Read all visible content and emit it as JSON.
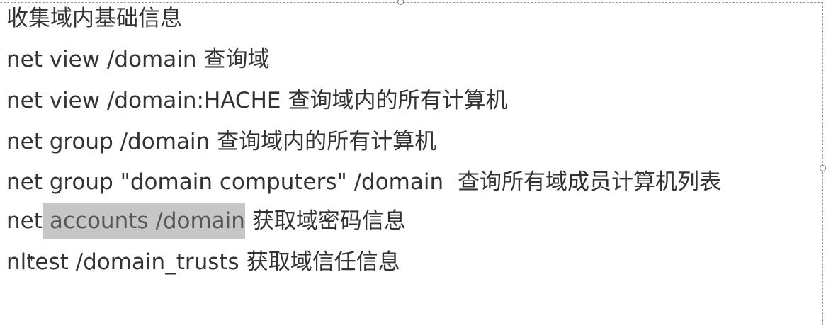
{
  "title": "收集域内基础信息",
  "lines": [
    {
      "cmd": "net view /domain",
      "desc": "查询域"
    },
    {
      "cmd": "net view /domain:HACHE",
      "desc": "查询域内的所有计算机"
    },
    {
      "cmd": "net group /domain",
      "desc": "查询域内的所有计算机"
    },
    {
      "cmd": "net group \"domain computers\" /domain",
      "desc": "查询所有域成员计算机列表"
    },
    {
      "cmd_prefix": "net",
      "cmd_highlight": "accounts /domain",
      "desc": "获取域密码信息"
    },
    {
      "cmd": "nltest /domain_trusts",
      "desc": "获取域信任信息"
    }
  ],
  "highlight_color": "#c6c6c6",
  "text_color": "#333333"
}
